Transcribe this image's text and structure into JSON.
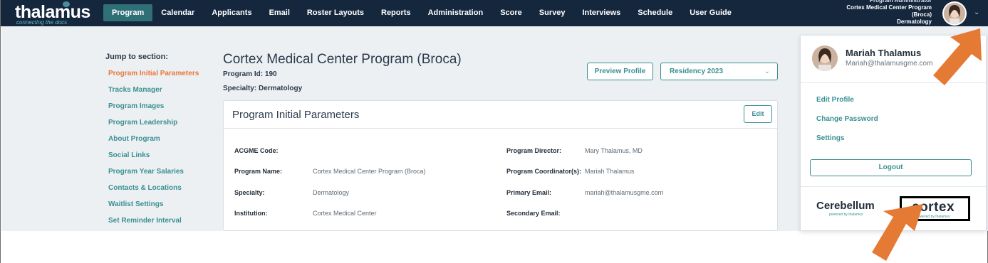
{
  "app": {
    "logo": "thalamus",
    "tagline": "connecting the docs"
  },
  "nav": {
    "items": [
      "Program",
      "Calendar",
      "Applicants",
      "Email",
      "Roster Layouts",
      "Reports",
      "Administration",
      "Score",
      "Survey",
      "Interviews",
      "Schedule",
      "User Guide"
    ],
    "active": "Program"
  },
  "user": {
    "role": "Program Administrator",
    "program_line1": "Cortex Medical Center Program",
    "program_line2": "(Broca)",
    "specialty": "Dermatology"
  },
  "sidebar": {
    "title": "Jump to section:",
    "items": [
      "Program Initial Parameters",
      "Tracks Manager",
      "Program Images",
      "Program Leadership",
      "About Program",
      "Social Links",
      "Program Year Salaries",
      "Contacts & Locations",
      "Waitlist Settings",
      "Set Reminder Interval"
    ]
  },
  "program": {
    "title": "Cortex Medical Center Program (Broca)",
    "id_line": "Program Id: 190",
    "specialty_line": "Specialty: Dermatology",
    "preview_button": "Preview Profile",
    "season_select": "Residency 2023"
  },
  "card": {
    "title": "Program Initial Parameters",
    "edit_button": "Edit",
    "left_fields": [
      {
        "label": "ACGME Code:",
        "value": ""
      },
      {
        "label": "Program Name:",
        "value": "Cortex Medical Center Program (Broca)"
      },
      {
        "label": "Specialty:",
        "value": "Dermatology"
      },
      {
        "label": "Institution:",
        "value": "Cortex Medical Center"
      }
    ],
    "right_fields": [
      {
        "label": "Program Director:",
        "value": "Mary Thalamus, MD"
      },
      {
        "label": "Program Coordinator(s):",
        "value": "Mariah Thalamus"
      },
      {
        "label": "Primary Email:",
        "value": "mariah@thalamusgme.com"
      },
      {
        "label": "Secondary Email:",
        "value": ""
      }
    ]
  },
  "dropdown": {
    "name": "Mariah Thalamus",
    "email": "Mariah@thalamusgme.com",
    "links": [
      "Edit Profile",
      "Change Password",
      "Settings"
    ],
    "logout": "Logout",
    "brand1": "Cerebellum",
    "brand1_tag": "powered by thalamus",
    "brand2": "cortex",
    "brand2_tag": "powered by thalamus"
  },
  "colors": {
    "topbar": "#15273d",
    "accent": "#3a8f92",
    "active_link": "#e8773a",
    "annotation_arrow": "#e57a35"
  },
  "icons": [
    "chevron-down-icon",
    "avatar-icon"
  ]
}
